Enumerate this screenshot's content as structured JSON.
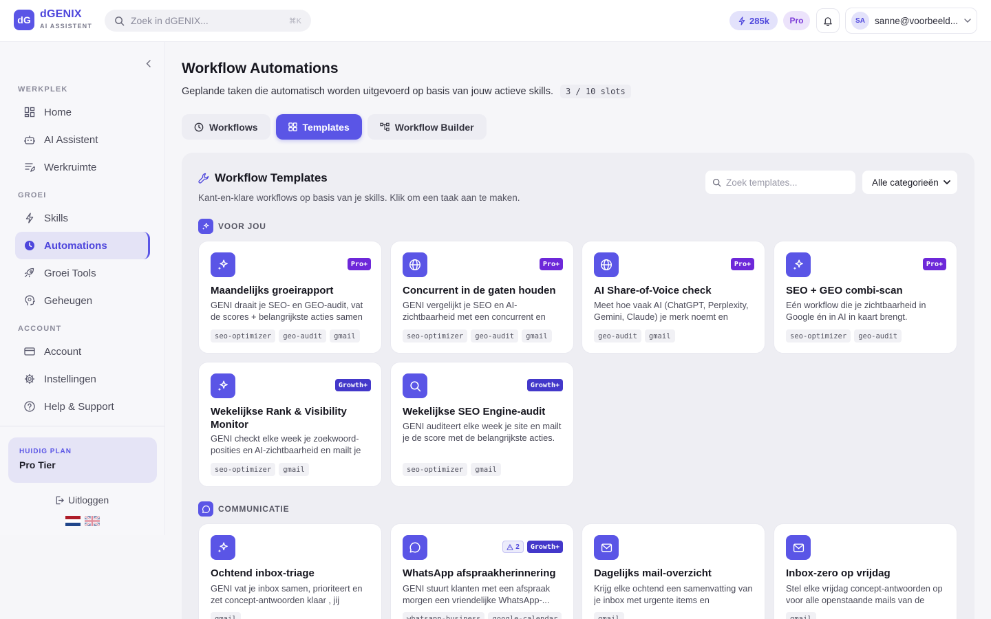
{
  "header": {
    "logo": "dG",
    "brand": "dGENIX",
    "brand_sub": "AI ASSISTENT",
    "search_placeholder": "Zoek in dGENIX...",
    "search_shortcut": "⌘K",
    "credits": "285k",
    "plan_badge": "Pro",
    "avatar_initials": "SA",
    "user_email": "sanne@voorbeeld..."
  },
  "sidebar": {
    "sections": [
      {
        "label": "WERKPLEK",
        "items": [
          {
            "label": "Home",
            "icon": "dashboard-icon"
          },
          {
            "label": "AI Assistent",
            "icon": "robot-icon"
          },
          {
            "label": "Werkruimte",
            "icon": "edit-list-icon"
          }
        ]
      },
      {
        "label": "GROEI",
        "items": [
          {
            "label": "Skills",
            "icon": "lightning-icon"
          },
          {
            "label": "Automations",
            "icon": "clock-icon",
            "active": true
          },
          {
            "label": "Groei Tools",
            "icon": "rocket-icon"
          },
          {
            "label": "Geheugen",
            "icon": "brain-icon"
          }
        ]
      },
      {
        "label": "ACCOUNT",
        "items": [
          {
            "label": "Account",
            "icon": "credit-card-icon"
          },
          {
            "label": "Instellingen",
            "icon": "gear-icon"
          },
          {
            "label": "Help & Support",
            "icon": "help-circle-icon"
          }
        ]
      }
    ],
    "plan_label": "HUIDIG PLAN",
    "plan_value": "Pro Tier",
    "logout": "Uitloggen"
  },
  "main": {
    "title": "Workflow Automations",
    "subtitle": "Geplande taken die automatisch worden uitgevoerd op basis van jouw actieve skills.",
    "slots": "3 / 10 slots",
    "tabs": [
      {
        "label": "Workflows",
        "icon": "clock-icon"
      },
      {
        "label": "Templates",
        "icon": "grid-icon",
        "active": true
      },
      {
        "label": "Workflow Builder",
        "icon": "flow-icon"
      }
    ],
    "panel": {
      "title": "Workflow Templates",
      "subtitle": "Kant-en-klare workflows op basis van je skills. Klik om een taak aan te maken.",
      "search_placeholder": "Zoek templates...",
      "category_select": "Alle categorieën"
    },
    "categories": [
      {
        "label": "VOOR JOU",
        "templates": [
          {
            "title": "Maandelijks groeirapport",
            "desc": "GENI draait je SEO- en GEO-audit, vat de scores + belangrijkste acties samen en...",
            "badge": "Pro+",
            "icon": "sparkles-icon",
            "chips": [
              "seo-optimizer",
              "geo-audit",
              "gmail"
            ]
          },
          {
            "title": "Concurrent in de gaten houden",
            "desc": "GENI vergelijkt je SEO en AI-zichtbaarheid met een concurrent en mailt je waar zij je...",
            "badge": "Pro+",
            "icon": "globe-icon",
            "chips": [
              "seo-optimizer",
              "geo-audit",
              "gmail"
            ]
          },
          {
            "title": "AI Share-of-Voice check",
            "desc": "Meet hoe vaak AI (ChatGPT, Perplexity, Gemini, Claude) je merk noemt en ontvan...",
            "badge": "Pro+",
            "icon": "globe-icon",
            "chips": [
              "geo-audit",
              "gmail"
            ]
          },
          {
            "title": "SEO + GEO combi-scan",
            "desc": "Eén workflow die je zichtbaarheid in Google én in AI in kaart brengt.",
            "badge": "Pro+",
            "icon": "sparkles-icon",
            "chips": [
              "seo-optimizer",
              "geo-audit"
            ]
          },
          {
            "title": "Wekelijkse Rank & Visibility Monitor",
            "desc": "GENI checkt elke week je zoekwoord-posities en AI-zichtbaarheid en mailt je d...",
            "badge": "Growth+",
            "icon": "sparkles-icon",
            "chips": [
              "seo-optimizer",
              "gmail"
            ]
          },
          {
            "title": "Wekelijkse SEO Engine-audit",
            "desc": "GENI auditeert elke week je site en mailt je de score met de belangrijkste acties.",
            "badge": "Growth+",
            "icon": "search-icon",
            "chips": [
              "seo-optimizer",
              "gmail"
            ]
          }
        ]
      },
      {
        "label": "COMMUNICATIE",
        "templates": [
          {
            "title": "Ochtend inbox-triage",
            "desc": "GENI vat je inbox samen, prioriteert en zet concept-antwoorden klaar , jij controleer...",
            "badge": "",
            "icon": "sparkles-icon",
            "chips": [
              "gmail"
            ]
          },
          {
            "title": "WhatsApp afspraakherinnering",
            "desc": "GENI stuurt klanten met een afspraak morgen een vriendelijke WhatsApp-...",
            "badge": "Growth+",
            "warning": "2",
            "icon": "chat-icon",
            "chips": [
              "whatsapp-business",
              "google-calendar"
            ]
          },
          {
            "title": "Dagelijks mail-overzicht",
            "desc": "Krijg elke ochtend een samenvatting van je inbox met urgente items en actiepunten.",
            "badge": "",
            "icon": "mail-icon",
            "chips": [
              "gmail"
            ]
          },
          {
            "title": "Inbox-zero op vrijdag",
            "desc": "Stel elke vrijdag concept-antwoorden op voor alle openstaande mails van de week.",
            "badge": "",
            "icon": "mail-icon",
            "chips": [
              "gmail"
            ]
          }
        ]
      }
    ]
  },
  "colors": {
    "accent": "#5a55e6",
    "pro_badge": "#6d28d9",
    "growth_badge": "#4338ca"
  }
}
